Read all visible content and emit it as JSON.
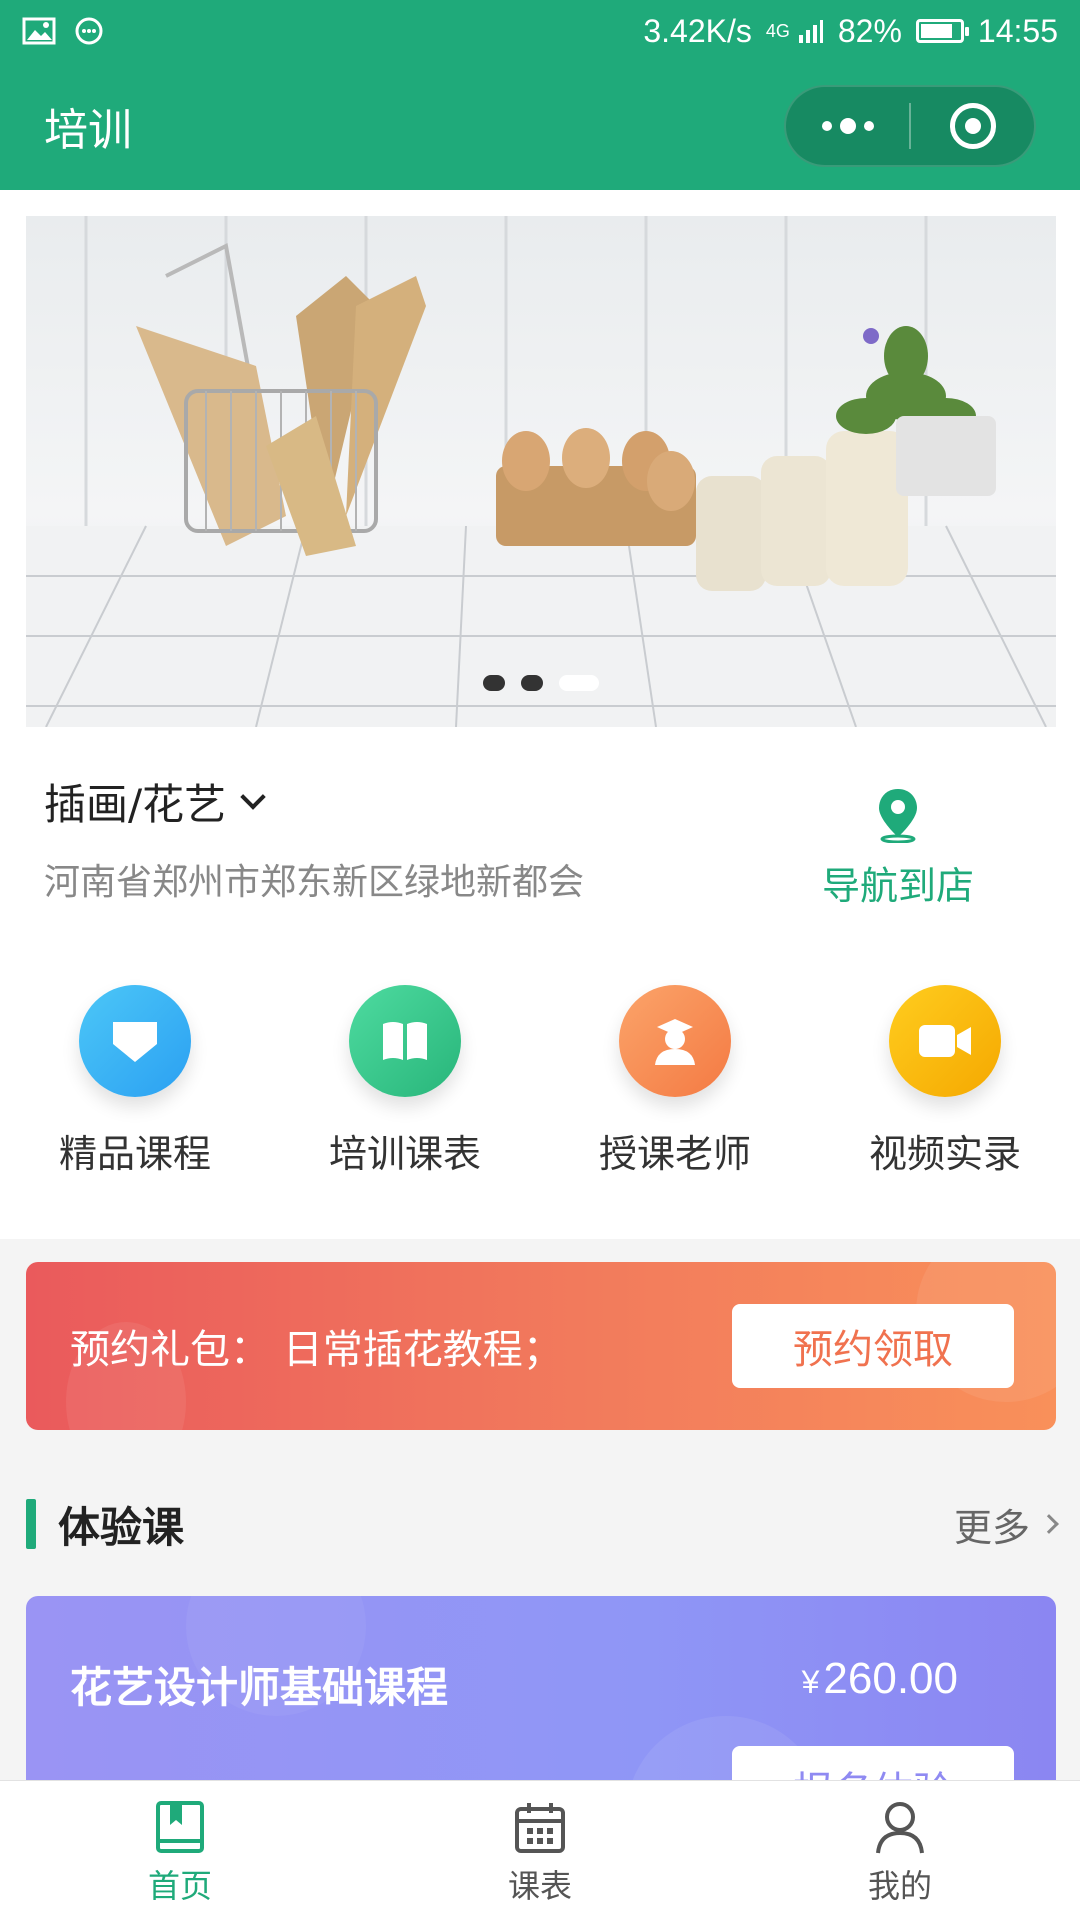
{
  "status_bar": {
    "speed": "3.42K/s",
    "network": "4G",
    "battery_percent": "82%",
    "battery_level": 0.82,
    "time": "14:55",
    "left_icons": [
      "image-icon",
      "chat-bubble-icon"
    ]
  },
  "nav": {
    "title": "培训",
    "more_icon": "more-dots-icon",
    "close_icon": "target-circle-icon"
  },
  "banner": {
    "pages": 3,
    "active_page": 3
  },
  "store": {
    "name": "插画/花艺",
    "address": "河南省郑州市郑东新区绿地新都会",
    "navigate_label": "导航到店"
  },
  "features": [
    {
      "label": "精品课程",
      "icon": "diamond-icon",
      "color": "#3eb0f5"
    },
    {
      "label": "培训课表",
      "icon": "book-icon",
      "color": "#34c98a"
    },
    {
      "label": "授课老师",
      "icon": "teacher-icon",
      "color": "#f78b52"
    },
    {
      "label": "视频实录",
      "icon": "video-camera-icon",
      "color": "#f7b500"
    }
  ],
  "promo": {
    "text": "预约礼包：  日常插花教程；",
    "button": "预约领取"
  },
  "section": {
    "title": "体验课",
    "more": "更多"
  },
  "course": {
    "title": "花艺设计师基础课程",
    "currency": "¥",
    "price": "260.00",
    "button": "报名体验"
  },
  "tabs": [
    {
      "label": "首页",
      "icon": "home-book-icon",
      "active": true
    },
    {
      "label": "课表",
      "icon": "calendar-icon",
      "active": false
    },
    {
      "label": "我的",
      "icon": "user-icon",
      "active": false
    }
  ],
  "colors": {
    "primary": "#1faa7a",
    "promo_start": "#ea5a5c",
    "promo_end": "#f9905a",
    "card": "#8f96f6"
  }
}
